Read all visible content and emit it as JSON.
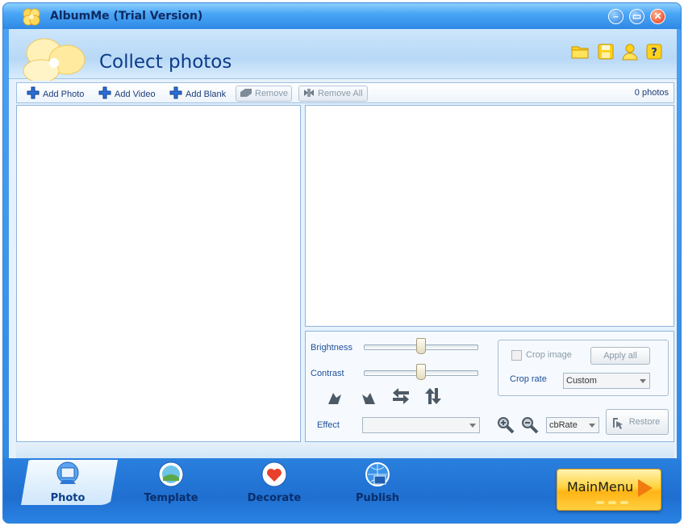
{
  "window": {
    "title": "AlbumMe (Trial Version)",
    "controls": [
      "minimize",
      "maximize",
      "close"
    ]
  },
  "header": {
    "title": "Collect photos",
    "icons": [
      "folder-icon",
      "save-icon",
      "user-icon",
      "help-icon"
    ]
  },
  "toolbar": {
    "add_photo": "Add Photo",
    "add_video": "Add Video",
    "add_blank": "Add Blank",
    "remove": "Remove",
    "remove_all": "Remove All",
    "photo_count": "0 photos"
  },
  "adjust": {
    "brightness_label": "Brightness",
    "brightness_value": 0.5,
    "contrast_label": "Contrast",
    "contrast_value": 0.5,
    "effect_label": "Effect",
    "effect_value": "",
    "tools": [
      "rotate-left-icon",
      "rotate-right-icon",
      "flip-horizontal-icon",
      "flip-vertical-icon"
    ]
  },
  "crop": {
    "checkbox_label": "Crop image",
    "checked": false,
    "apply_all": "Apply all",
    "rate_label": "Crop rate",
    "rate_value": "Custom",
    "zoom_combo_value": "cbRate",
    "restore": "Restore"
  },
  "nav": {
    "tabs": [
      {
        "label": "Photo",
        "active": true
      },
      {
        "label": "Template",
        "active": false
      },
      {
        "label": "Decorate",
        "active": false
      },
      {
        "label": "Publish",
        "active": false
      }
    ],
    "main_menu": "MainMenu"
  },
  "colors": {
    "accent_blue": "#2f86e3",
    "title_text": "#0e2a62",
    "label_blue": "#1f4f9a",
    "main_menu_orange": "#ffb414"
  }
}
